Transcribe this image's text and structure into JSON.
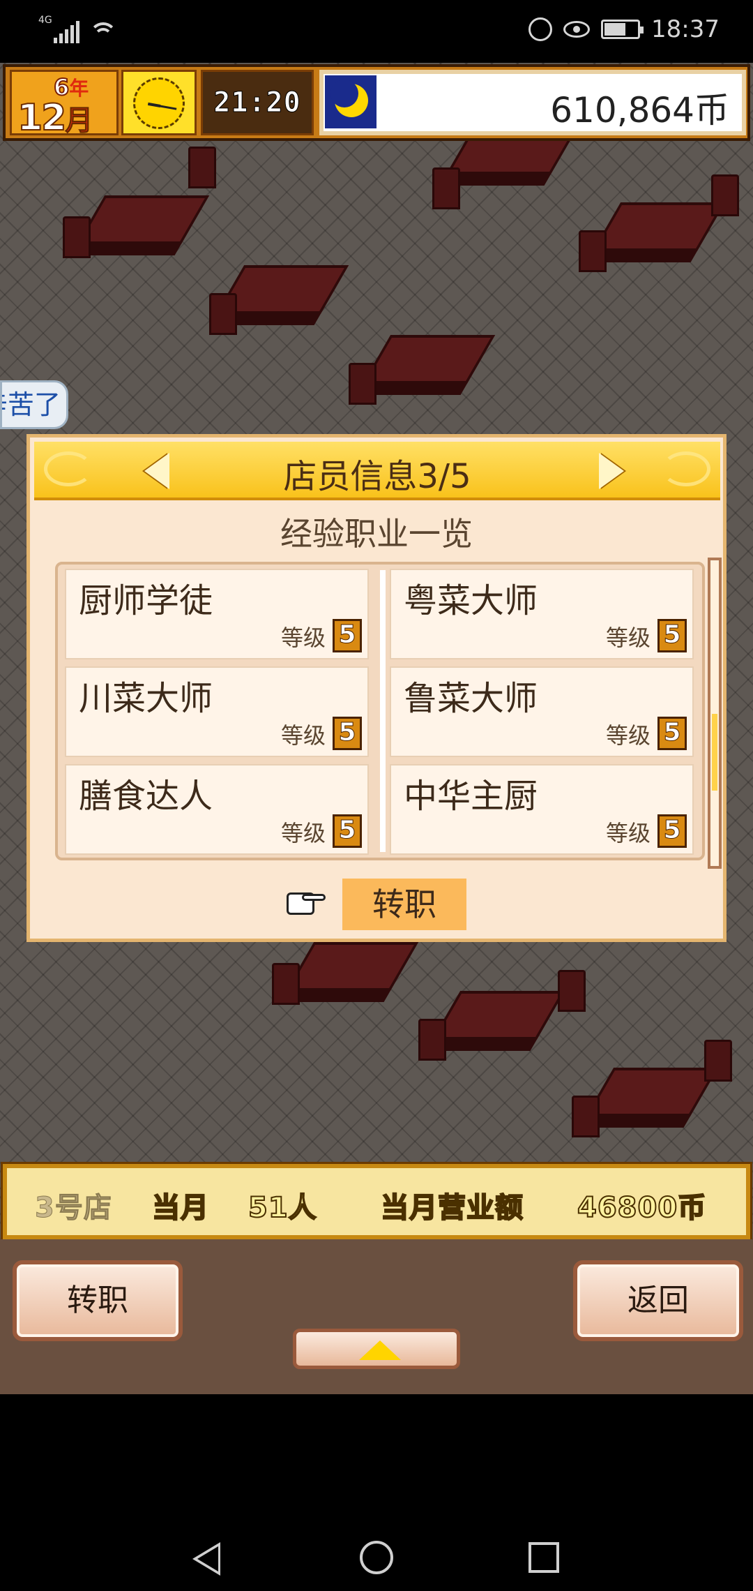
{
  "status_bar": {
    "network": "4G",
    "time": "18:37"
  },
  "hud": {
    "year": "6",
    "year_unit": "年",
    "month": "12",
    "month_unit": "月",
    "game_time": "21:20",
    "money": "610,864币"
  },
  "speech_bubble": "辛苦了",
  "dialog": {
    "title": "店员信息3/5",
    "subtitle": "经验职业一览",
    "jobs": [
      {
        "name": "厨师学徒",
        "level_label": "等级",
        "level": "5"
      },
      {
        "name": "粤菜大师",
        "level_label": "等级",
        "level": "5"
      },
      {
        "name": "川菜大师",
        "level_label": "等级",
        "level": "5"
      },
      {
        "name": "鲁菜大师",
        "level_label": "等级",
        "level": "5"
      },
      {
        "name": "膳食达人",
        "level_label": "等级",
        "level": "5"
      },
      {
        "name": "中华主厨",
        "level_label": "等级",
        "level": "5"
      }
    ],
    "action_label": "转职"
  },
  "info_bar": {
    "shop": "3号店",
    "month_label": "当月",
    "customers": "51人",
    "revenue_label": "当月营业额",
    "revenue": "46800币"
  },
  "buttons": {
    "left": "转职",
    "right": "返回"
  },
  "colors": {
    "dialog_bg": "#fbe7d1",
    "header_gold": "#f9c21b",
    "hud_orange": "#c77b16",
    "action_highlight": "#fbb95b"
  }
}
